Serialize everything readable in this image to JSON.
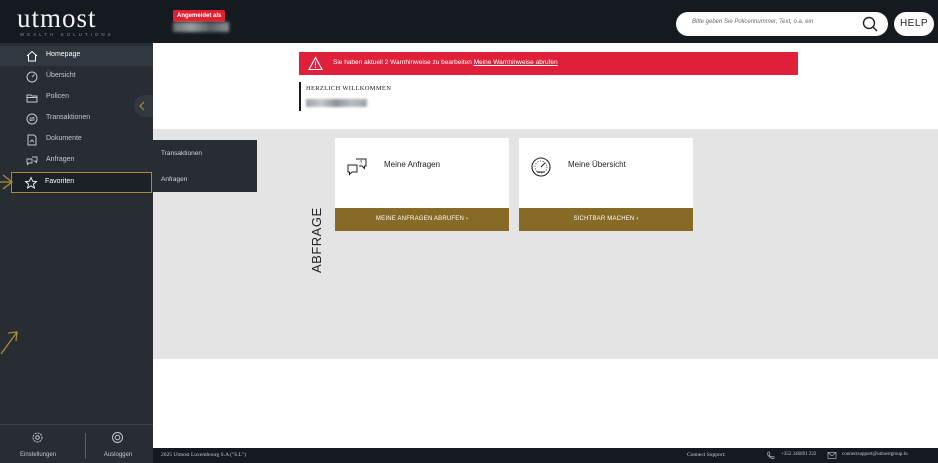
{
  "header": {
    "logo": "utmost",
    "logo_tagline": "WEALTH SOLUTIONS",
    "login_badge": "Angemeldet als",
    "search_placeholder": "Bitte geben Sie Policennummer, Text, o.a. ein",
    "help_label": "HELP"
  },
  "sidebar": {
    "items": [
      {
        "label": "Homepage",
        "icon": "home-icon"
      },
      {
        "label": "Übersicht",
        "icon": "gauge-icon"
      },
      {
        "label": "Policen",
        "icon": "folder-icon"
      },
      {
        "label": "Transaktionen",
        "icon": "exchange-icon"
      },
      {
        "label": "Dokumente",
        "icon": "document-icon"
      },
      {
        "label": "Anfragen",
        "icon": "inquiry-icon"
      },
      {
        "label": "Favoriten",
        "icon": "star-icon"
      }
    ],
    "footer": {
      "settings_label": "Einstellungen",
      "logout_label": "Ausloggen"
    }
  },
  "flyout": {
    "items": [
      "Transaktionen",
      "Anfragen"
    ]
  },
  "main": {
    "alert_text": "Sie haben aktuell 2 Warnhinweise zu bearbeiten",
    "alert_link": "Meine Warnhinweise abrufen",
    "welcome_title": "HERZLICH WILLKOMMEN",
    "section_label": "ABFRAGE",
    "cards": [
      {
        "title": "Meine Anfragen",
        "button": "MEINE ANFRAGEN ABRUFEN  ›",
        "icon": "inquiry-icon"
      },
      {
        "title": "Meine Übersicht",
        "button": "SICHTBAR MACHEN  ›",
        "icon": "gauge-icon"
      }
    ]
  },
  "footer": {
    "copyright": "2025 Utmost Luxembourg S.A (\"S.L\")",
    "support_label": "Connect Support:",
    "phone": "+352 346891 222",
    "email": "connectsupport@utmostgroup.lu"
  },
  "colors": {
    "accent_gold": "#876a25",
    "alert_red": "#e0203a",
    "sidebar_bg": "#272d33",
    "topbar_bg": "#141a1f"
  }
}
